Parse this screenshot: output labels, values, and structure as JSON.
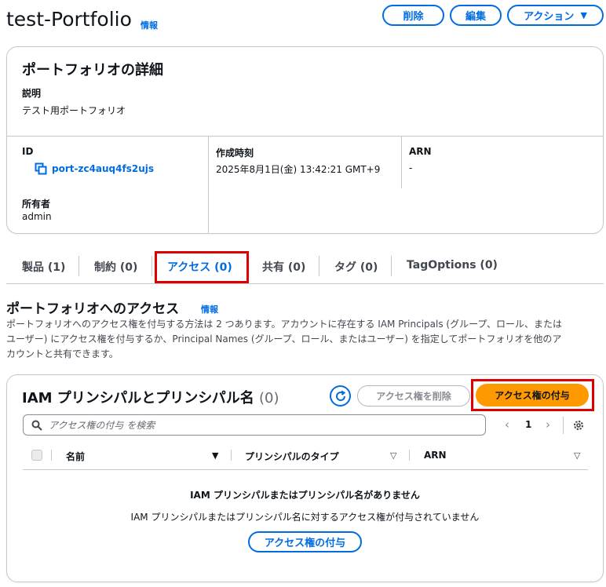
{
  "header": {
    "title": "test-Portfolio",
    "info": "情報",
    "delete_label": "削除",
    "edit_label": "編集",
    "actions_label": "アクション"
  },
  "details": {
    "heading": "ポートフォリオの詳細",
    "description_label": "説明",
    "description_value": "テスト用ポートフォリオ",
    "id_label": "ID",
    "id_value": "port-zc4auq4fs2ujs",
    "created_label": "作成時刻",
    "created_value": "2025年8月1日(金) 13:42:21 GMT+9",
    "arn_label": "ARN",
    "arn_value": "-",
    "owner_label": "所有者",
    "owner_value": "admin"
  },
  "tabs": [
    {
      "label": "製品 (1)"
    },
    {
      "label": "制約 (0)"
    },
    {
      "label": "アクセス (0)",
      "active": true
    },
    {
      "label": "共有 (0)"
    },
    {
      "label": "タグ (0)"
    },
    {
      "label": "TagOptions (0)"
    }
  ],
  "access": {
    "title": "ポートフォリオへのアクセス",
    "info": "情報",
    "description_line1": "ポートフォリオへのアクセス権を付与する方法は 2 つあります。アカウントに存在する IAM Principals (グループ、ロール、または",
    "description_line2": "ユーザー) にアクセス権を付与するか、Principal Names (グループ、ロール、またはユーザー) を指定してポートフォリオを他のア",
    "description_line3": "カウントと共有できます。"
  },
  "table": {
    "title": "IAM プリンシパルとプリンシパル名",
    "count": "(0)",
    "remove_label": "アクセス権を削除",
    "grant_label": "アクセス権の付与",
    "search_placeholder": "アクセス権の付与 を検索",
    "page_number": "1",
    "columns": [
      "名前",
      "プリンシパルのタイプ",
      "ARN"
    ],
    "empty_title": "IAM プリンシパルまたはプリンシパル名がありません",
    "empty_desc": "IAM プリンシパルまたはプリンシパル名に対するアクセス権が付与されていません",
    "empty_grant_label": "アクセス権の付与"
  },
  "colors": {
    "link": "#006ce0",
    "primary": "#ff9900",
    "highlight": "#e00000",
    "border": "#c6c6cd"
  }
}
